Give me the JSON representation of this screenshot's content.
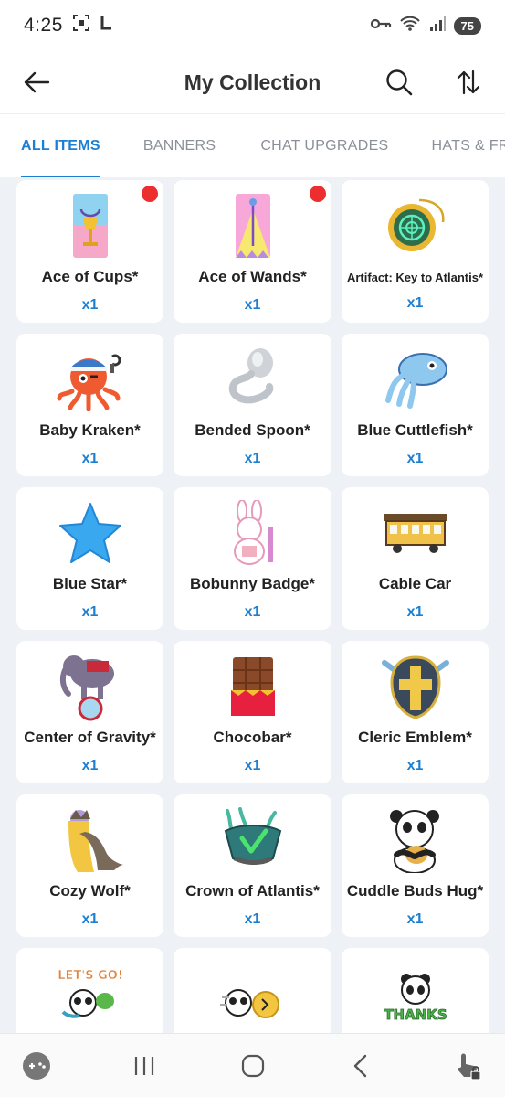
{
  "status": {
    "time": "4:25",
    "battery": "75"
  },
  "header": {
    "title": "My Collection"
  },
  "tabs": [
    {
      "label": "ALL ITEMS",
      "active": true
    },
    {
      "label": "BANNERS",
      "active": false
    },
    {
      "label": "CHAT UPGRADES",
      "active": false
    },
    {
      "label": "HATS & FRA",
      "active": false
    }
  ],
  "items": [
    {
      "name": "Ace of Cups*",
      "qty": "x1",
      "new": true,
      "icon": "ace-of-cups-icon"
    },
    {
      "name": "Ace of Wands*",
      "qty": "x1",
      "new": true,
      "icon": "ace-of-wands-icon"
    },
    {
      "name": "Artifact: Key to Atlantis*",
      "qty": "x1",
      "new": false,
      "icon": "atlantis-key-icon"
    },
    {
      "name": "Baby Kraken*",
      "qty": "x1",
      "new": false,
      "icon": "baby-kraken-icon"
    },
    {
      "name": "Bended Spoon*",
      "qty": "x1",
      "new": false,
      "icon": "bended-spoon-icon"
    },
    {
      "name": "Blue Cuttlefish*",
      "qty": "x1",
      "new": false,
      "icon": "blue-cuttlefish-icon"
    },
    {
      "name": "Blue Star*",
      "qty": "x1",
      "new": false,
      "icon": "blue-star-icon"
    },
    {
      "name": "Bobunny Badge*",
      "qty": "x1",
      "new": false,
      "icon": "bobunny-badge-icon"
    },
    {
      "name": "Cable Car",
      "qty": "x1",
      "new": false,
      "icon": "cable-car-icon"
    },
    {
      "name": "Center of Gravity*",
      "qty": "x1",
      "new": false,
      "icon": "center-of-gravity-icon"
    },
    {
      "name": "Chocobar*",
      "qty": "x1",
      "new": false,
      "icon": "chocobar-icon"
    },
    {
      "name": "Cleric Emblem*",
      "qty": "x1",
      "new": false,
      "icon": "cleric-emblem-icon"
    },
    {
      "name": "Cozy Wolf*",
      "qty": "x1",
      "new": false,
      "icon": "cozy-wolf-icon"
    },
    {
      "name": "Crown of Atlantis*",
      "qty": "x1",
      "new": false,
      "icon": "crown-of-atlantis-icon"
    },
    {
      "name": "Cuddle Buds Hug*",
      "qty": "x1",
      "new": false,
      "icon": "cuddle-buds-hug-icon"
    },
    {
      "name": "",
      "qty": "",
      "new": false,
      "icon": "lets-go-panda-icon",
      "sticker_text": "LET'S GO!"
    },
    {
      "name": "",
      "qty": "",
      "new": false,
      "icon": "racing-panda-icon"
    },
    {
      "name": "",
      "qty": "",
      "new": false,
      "icon": "thanks-panda-icon",
      "sticker_text": "THANKS"
    }
  ],
  "colors": {
    "accent": "#1c7fd2",
    "new_dot": "#ec2e2e",
    "grid_bg": "#eef1f5"
  }
}
